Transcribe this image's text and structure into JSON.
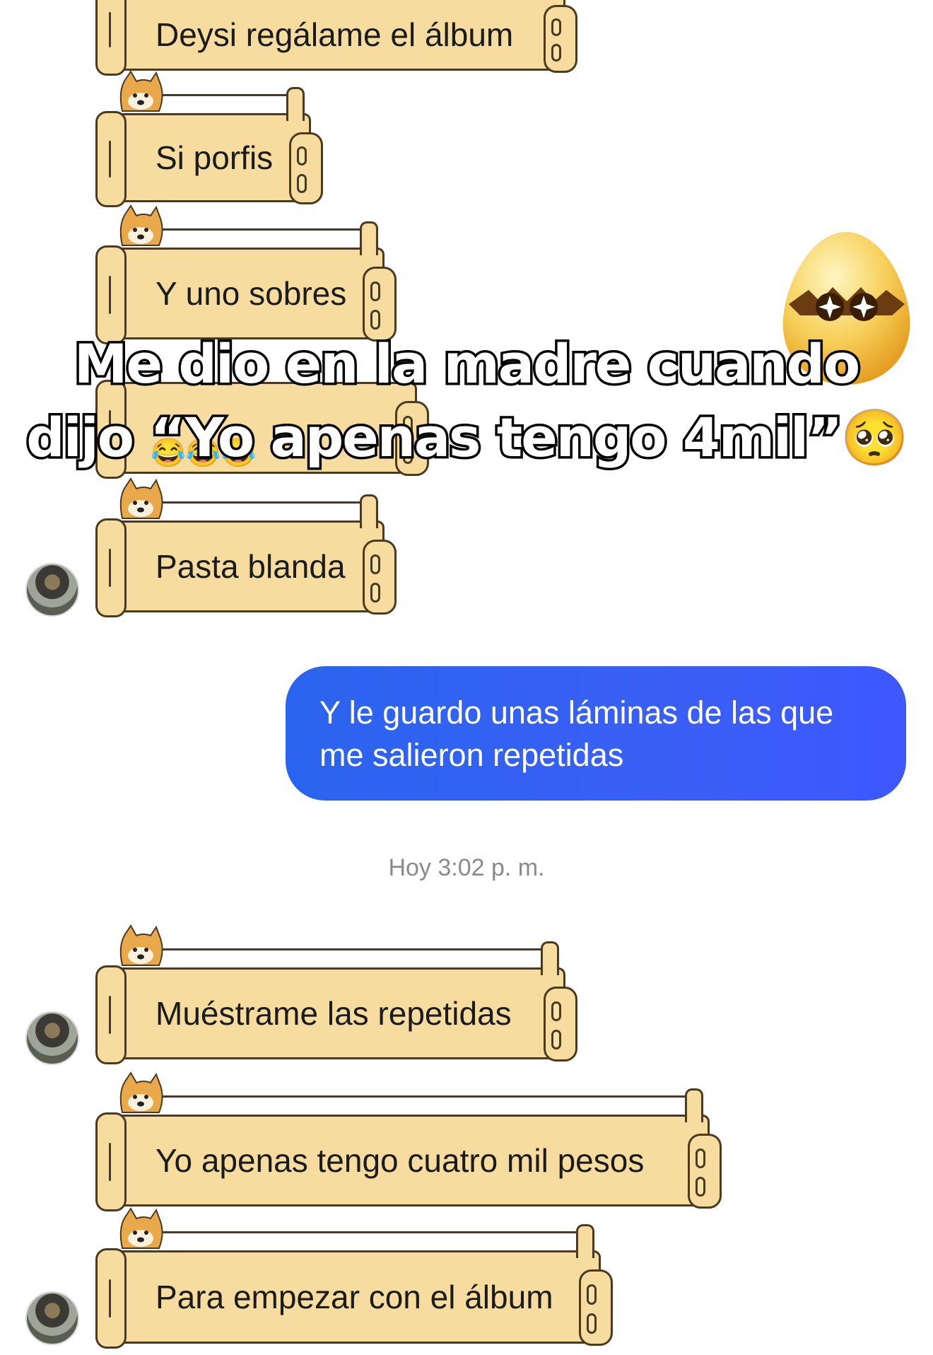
{
  "messages": [
    {
      "text": "Deysi regálame el álbum"
    },
    {
      "text": "Si porfis"
    },
    {
      "text": "Y uno sobres"
    },
    {
      "text": ""
    },
    {
      "text": "Pasta blanda"
    },
    {
      "text": "Muéstrame las repetidas"
    },
    {
      "text": "Yo apenas tengo cuatro mil pesos"
    },
    {
      "text": "Para empezar con el álbum"
    }
  ],
  "outgoing": {
    "line1": "Y le guardo unas láminas de las que",
    "line2": "me salieron repetidas"
  },
  "timestamp": "Hoy 3:02 p. m.",
  "caption": {
    "line1": "Me dio en la madre cuando",
    "line2": "dijo “Yo apenas tengo 4mil”🥺"
  },
  "hidden_bubble_emojis": "😂😂😂",
  "colors": {
    "bubble_fill": "#f6dc9f",
    "bubble_outline": "#4b3a20",
    "outgoing_start": "#2a64ee",
    "outgoing_end": "#3d58ff",
    "timestamp": "#8a8a8a"
  },
  "icons": {
    "sticker": "egg-sparkle-eyes-sticker",
    "bubble_decoration": "doge-head-icon",
    "avatar": "user-avatar"
  }
}
